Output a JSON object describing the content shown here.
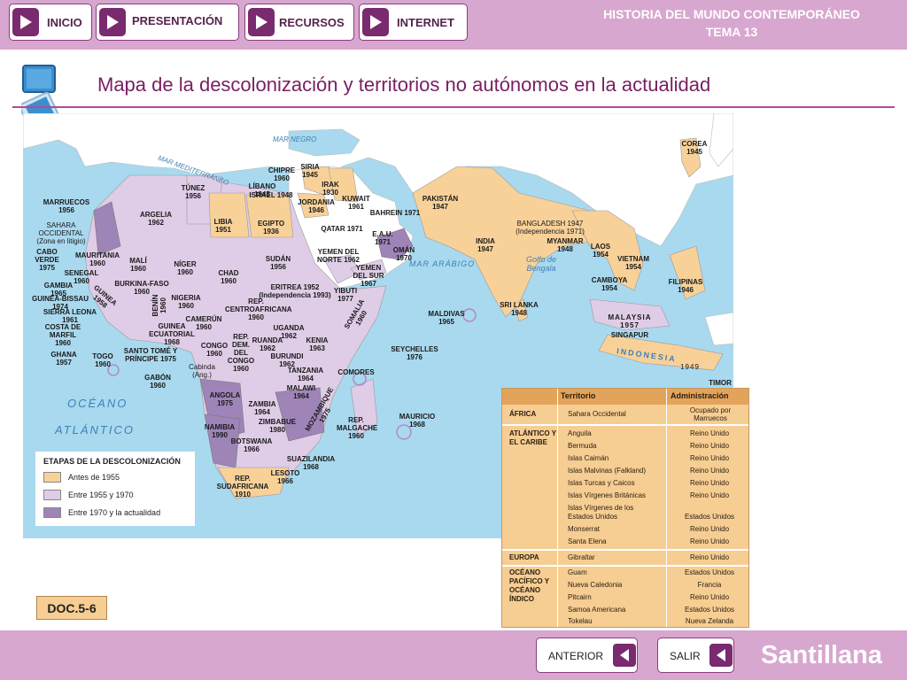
{
  "header": {
    "nav": [
      "INICIO",
      "PRESENTACIÓN",
      "RECURSOS",
      "INTERNET"
    ],
    "title_line1": "HISTORIA DEL MUNDO CONTEMPORÁNEO",
    "title_line2": "TEMA 13"
  },
  "main": {
    "title": "Mapa de la descolonización y territorios no autónomos en la actualidad",
    "doc_tag": "DOC.5-6"
  },
  "map": {
    "seas": [
      "MAR NEGRO",
      "MAR MEDITERRÁNEO",
      "MAR ARÁBIGO",
      "Golfo de Bengala",
      "OCÉANO",
      "ATLÁNTICO",
      "INDONESIA"
    ],
    "labels": [
      "MARRUECOS 1956",
      "TÚNEZ 1956",
      "ARGELIA 1962",
      "LIBIA 1951",
      "EGIPTO 1936",
      "SAHARA OCCIDENTAL (Zona en litigio)",
      "CABO VERDE 1975",
      "MAURITANIA 1960",
      "MALÍ 1960",
      "NÍGER 1960",
      "CHAD 1960",
      "SUDÁN 1956",
      "SENEGAL 1960",
      "GAMBIA 1965",
      "GUINEA-BISSAU 1974",
      "SIERRA LEONA 1961",
      "COSTA DE MARFIL 1960",
      "GHANA 1957",
      "TOGO 1960",
      "BENÍN 1960",
      "BURKINA-FASO 1960",
      "NIGERIA 1960",
      "GUINEA 1958",
      "CAMERÚN 1960",
      "GUINEA ECUATORIAL 1968",
      "SANTO TOMÉ Y PRÍNCIPE 1975",
      "GABÓN 1960",
      "CONGO 1960",
      "REP. CENTROAFRICANA 1960",
      "REP. DEM. DEL CONGO 1960",
      "Cabinda (Ang.)",
      "ERITREA 1952 (Independencia 1993)",
      "YIBUTI 1977",
      "SOMALIA 1960",
      "UGANDA 1962",
      "KENIA 1963",
      "RUANDA 1962",
      "BURUNDI 1962",
      "TANZANIA 1964",
      "MALAWI 1964",
      "ANGOLA 1975",
      "ZAMBIA 1964",
      "ZIMBABUE 1980",
      "MOZAMBIQUE 1975",
      "NAMIBIA 1990",
      "BOTSWANA 1966",
      "SUAZILANDIA 1968",
      "LESOTO 1966",
      "REP. SUDAFRICANA 1910",
      "COMORES",
      "SEYCHELLES 1976",
      "REP. MALGACHE 1960",
      "MAURICIO 1968",
      "CHIPRE 1960",
      "SIRIA 1945",
      "LÍBANO 1945",
      "ISRAEL 1948",
      "IRAK 1930",
      "JORDANIA 1946",
      "KUWAIT 1961",
      "BAHREIN 1971",
      "QATAR 1971",
      "E.A.U. 1971",
      "OMÁN 1970",
      "YEMEN DEL NORTE 1962",
      "YEMEN DEL SUR 1967",
      "PAKISTÁN 1947",
      "INDIA 1947",
      "BANGLADESH 1947 (Independencia 1971)",
      "MYANMAR 1948",
      "LAOS 1954",
      "VIETNAM 1954",
      "CAMBOYA 1954",
      "SRI LANKA 1948",
      "MALDIVAS 1965",
      "MALAYSIA 1957",
      "SINGAPUR",
      "FILIPINAS 1946",
      "COREA 1945",
      "TIMOR",
      "1949"
    ]
  },
  "legend": {
    "title": "ETAPAS DE LA DESCOLONIZACIÓN",
    "items": [
      {
        "label": "Antes de 1955",
        "color": "#f8d199"
      },
      {
        "label": "Entre 1955 y 1970",
        "color": "#dfcce6"
      },
      {
        "label": "Entre 1970 y la actualidad",
        "color": "#9f84b8"
      }
    ]
  },
  "table": {
    "headers": [
      "Territorio",
      "Administración"
    ],
    "groups": [
      {
        "region": "ÁFRICA",
        "rows": [
          [
            "Sahara Occidental",
            "Ocupado por Marruecos"
          ]
        ]
      },
      {
        "region": "ATLÁNTICO Y EL CARIBE",
        "rows": [
          [
            "Anguila",
            "Reino Unido"
          ],
          [
            "Bermuda",
            "Reino Unido"
          ],
          [
            "Islas Caimán",
            "Reino Unido"
          ],
          [
            "Islas Malvinas (Falkland)",
            "Reino Unido"
          ],
          [
            "Islas Turcas y Caicos",
            "Reino Unido"
          ],
          [
            "Islas Vírgenes Británicas",
            "Reino Unido"
          ],
          [
            "Islas Vírgenes de los Estados Unidos",
            "Estados Unidos"
          ],
          [
            "Monserrat",
            "Reino Unido"
          ],
          [
            "Santa Elena",
            "Reino Unido"
          ]
        ]
      },
      {
        "region": "EUROPA",
        "rows": [
          [
            "Gibraltar",
            "Reino Unido"
          ]
        ]
      },
      {
        "region": "OCÉANO PACÍFICO Y OCÉANO ÍNDICO",
        "rows": [
          [
            "Guam",
            "Estados Unidos"
          ],
          [
            "Nueva Caledonia",
            "Francia"
          ],
          [
            "Pitcairn",
            "Reino Unido"
          ],
          [
            "Samoa Americana",
            "Estados Unidos"
          ],
          [
            "Tokelau",
            "Nueva Zelanda"
          ]
        ]
      }
    ]
  },
  "footer": {
    "prev_label": "ANTERIOR",
    "exit_label": "SALIR",
    "brand": "Santillana"
  },
  "colors": {
    "accent": "#7a2a6e",
    "bar": "#d8a7cf",
    "title": "#7a1e63"
  }
}
